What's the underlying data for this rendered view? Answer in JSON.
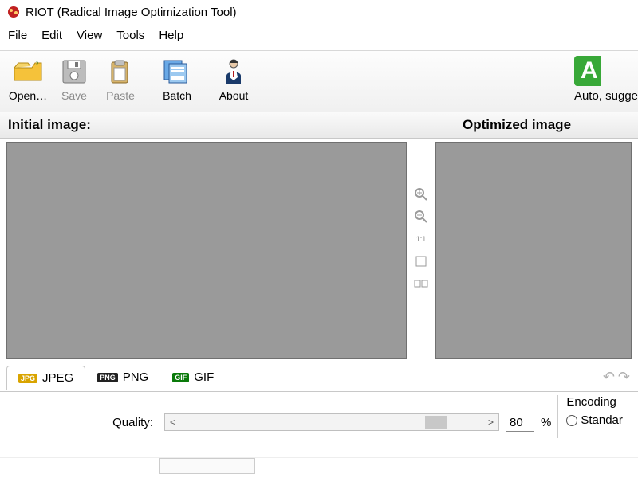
{
  "title": "RIOT (Radical Image Optimization Tool)",
  "menu": {
    "file": "File",
    "edit": "Edit",
    "view": "View",
    "tools": "Tools",
    "help": "Help"
  },
  "toolbar": {
    "open": "Open…",
    "save": "Save",
    "paste": "Paste",
    "batch": "Batch",
    "about": "About",
    "auto_badge": "A",
    "auto_text": "Auto, sugge"
  },
  "panes": {
    "initial_label": "Initial image:",
    "optimized_label": "Optimized image"
  },
  "midtools": {
    "one_to_one": "1:1"
  },
  "tabs": {
    "jpeg": "JPEG",
    "png": "PNG",
    "gif": "GIF",
    "badge_jpeg": "JPG",
    "badge_png": "PNG",
    "badge_gif": "GIF"
  },
  "quality": {
    "label": "Quality:",
    "value": "80",
    "percent": "%"
  },
  "scroll": {
    "left": "<",
    "right": ">"
  },
  "encoding": {
    "title": "Encoding",
    "standard": "Standar"
  }
}
